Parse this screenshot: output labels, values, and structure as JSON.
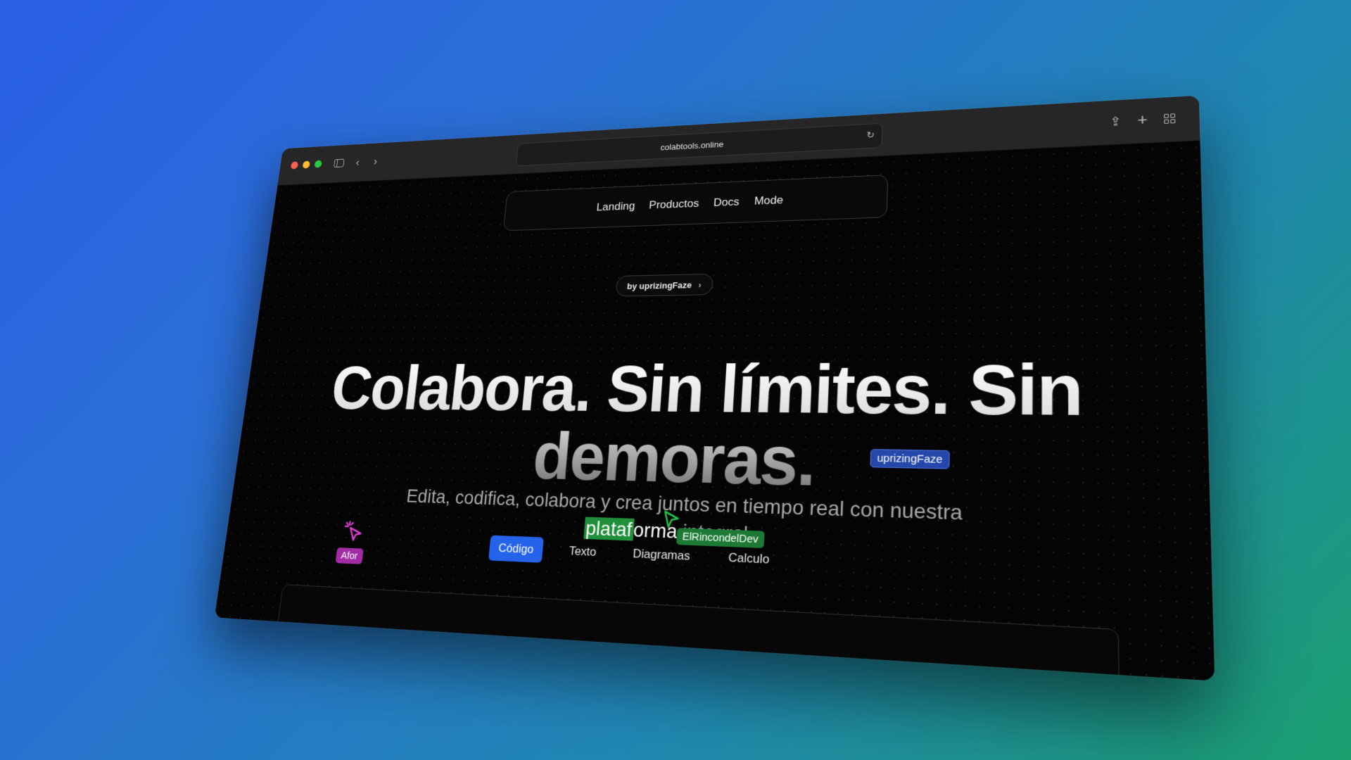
{
  "browser": {
    "url": "colabtools.online",
    "traffic_colors": {
      "close": "#ff5f57",
      "minimize": "#febc2e",
      "zoom": "#28c840"
    }
  },
  "nav": {
    "items": [
      "Landing",
      "Productos",
      "Docs",
      "Mode"
    ]
  },
  "badge": {
    "label": "by uprizingFaze",
    "chevron": "›"
  },
  "hero": {
    "headline": "Colabora. Sin límites. Sin demoras.",
    "subtitle_part1": "Edita, codifica, colabora y crea juntos en tiempo real con nuestra",
    "subtitle_highlight_a": "plataf",
    "subtitle_highlight_b": "orma",
    "subtitle_part2": "integral"
  },
  "collaborators": [
    {
      "name": "uprizingFaze",
      "color": "#2447a9"
    },
    {
      "name": "ElRincondelDev",
      "color": "#1d7a35"
    },
    {
      "name": "Afor",
      "color": "#a12ca6"
    }
  ],
  "mode_tabs": {
    "items": [
      "Código",
      "Texto",
      "Diagramas",
      "Calculo"
    ],
    "active": "Código",
    "active_color": "#2563eb"
  },
  "icons": [
    "sidebar-icon",
    "back-icon",
    "forward-icon",
    "reload-icon",
    "share-icon",
    "new-tab-icon",
    "tab-overview-icon",
    "cursor-arrow-icon",
    "click-cursor-icon"
  ]
}
